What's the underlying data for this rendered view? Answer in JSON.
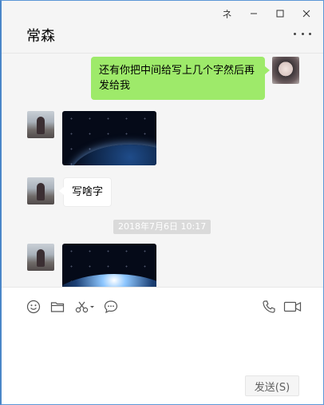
{
  "window": {
    "controls": {
      "pin_label": "ネ",
      "minimize_label": "–",
      "maximize_label": "□",
      "close_label": "✕"
    }
  },
  "chat": {
    "title": "常森"
  },
  "messages": {
    "m1_text": "还有你把中间给写上几个字然后再发给我",
    "m2_alt": "earth-from-space image",
    "m3_text": "写啥字",
    "timestamp": "2018年7月6日 10:17",
    "m4_alt": "sunrise-over-earth image"
  },
  "composer": {
    "send_label": "发送(S)",
    "input_value": ""
  },
  "icons": {
    "emoji": "emoji-icon",
    "folder": "folder-icon",
    "scissors": "scissors-icon",
    "chat_bubble": "chat-bubble-icon",
    "phone": "phone-icon",
    "video": "video-icon"
  },
  "colors": {
    "outgoing_bubble": "#9eea6a",
    "incoming_bubble": "#ffffff",
    "window_border": "#5b97d6",
    "background": "#f5f5f5"
  }
}
